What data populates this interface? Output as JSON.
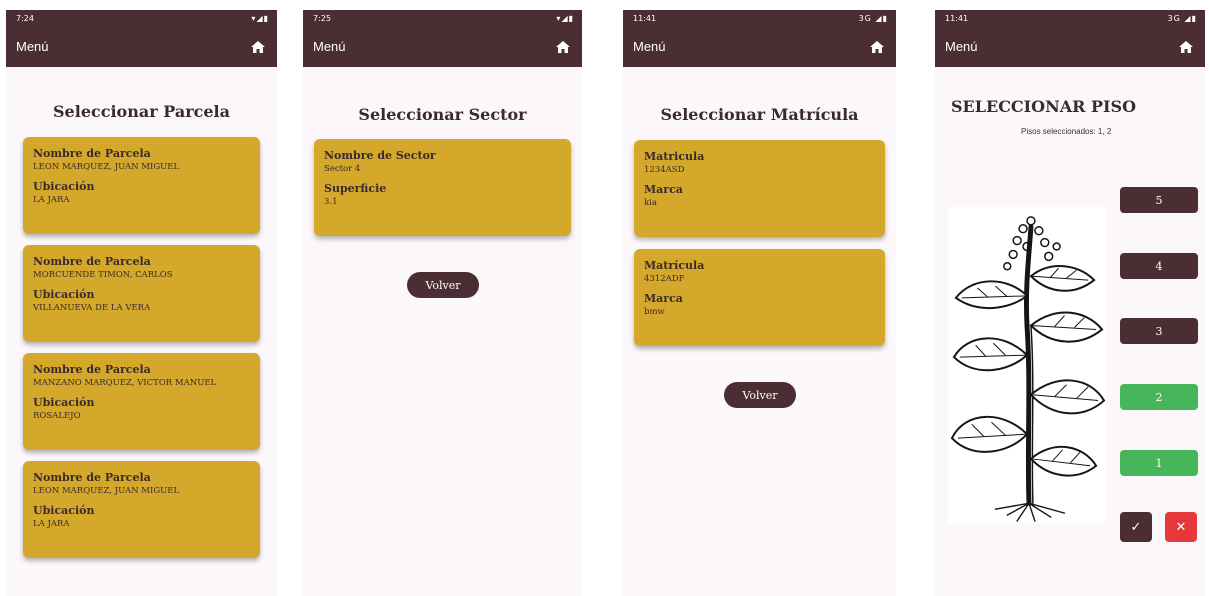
{
  "common": {
    "menu_label": "Menú",
    "status_icons_right": "▾◢▮"
  },
  "screen1": {
    "time": "7:24",
    "title": "Seleccionar Parcela",
    "cards": [
      {
        "label1": "Nombre de Parcela",
        "value1": "LEON MARQUEZ, JUAN MIGUEL",
        "label2": "Ubicación",
        "value2": "LA JARA"
      },
      {
        "label1": "Nombre de Parcela",
        "value1": "MORCUENDE TIMON, CARLOS",
        "label2": "Ubicación",
        "value2": "VILLANUEVA DE LA VERA"
      },
      {
        "label1": "Nombre de Parcela",
        "value1": "MANZANO MARQUEZ, VICTOR MANUEL",
        "label2": "Ubicación",
        "value2": "ROSALEJO"
      },
      {
        "label1": "Nombre de Parcela",
        "value1": "LEON MARQUEZ, JUAN MIGUEL",
        "label2": "Ubicación",
        "value2": "LA JARA"
      }
    ]
  },
  "screen2": {
    "time": "7:25",
    "title": "Seleccionar Sector",
    "cards": [
      {
        "label1": "Nombre de Sector",
        "value1": "Sector 4",
        "label2": "Superficie",
        "value2": "3.1"
      }
    ],
    "back_label": "Volver"
  },
  "screen3": {
    "time": "11:41",
    "network": "3G",
    "title": "Seleccionar Matrícula",
    "cards": [
      {
        "label1": "Matricula",
        "value1": "1234ASD",
        "label2": "Marca",
        "value2": "kia"
      },
      {
        "label1": "Matrícula",
        "value1": "4312ADF",
        "label2": "Marca",
        "value2": "bmw"
      }
    ],
    "back_label": "Volver"
  },
  "screen4": {
    "time": "11:41",
    "network": "3G",
    "title": "SELECCIONAR PISO",
    "selected_text": "Pisos seleccionados: 1, 2",
    "floors": [
      {
        "label": "5",
        "selected": false
      },
      {
        "label": "4",
        "selected": false
      },
      {
        "label": "3",
        "selected": false
      },
      {
        "label": "2",
        "selected": true
      },
      {
        "label": "1",
        "selected": true
      }
    ],
    "confirm_icon": "check-icon",
    "cancel_icon": "close-icon",
    "confirm_glyph": "✓",
    "cancel_glyph": "✕",
    "colors": {
      "selected": "#47b55a",
      "unselected": "#4a2e34",
      "cancel": "#e53838"
    }
  }
}
